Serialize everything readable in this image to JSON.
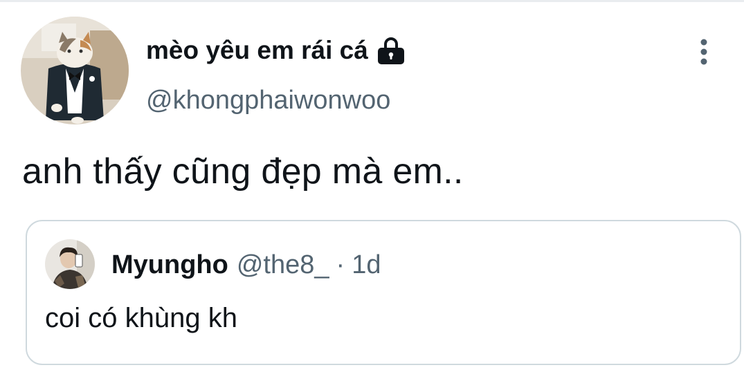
{
  "tweet": {
    "author": {
      "display_name": "mèo yêu em rái cá",
      "handle": "@khongphaiwonwoo",
      "avatar_icon": "cat-in-tuxedo-avatar",
      "protected_icon": "lock-icon"
    },
    "more_icon": "vertical-ellipsis-icon",
    "text": "anh thấy cũng đẹp mà em..",
    "quoted": {
      "display_name": "Myungho",
      "handle": "@the8_",
      "separator": "·",
      "time": "1d",
      "avatar_icon": "person-mirror-selfie-avatar",
      "text": "coi có khùng kh"
    }
  },
  "colors": {
    "text_primary": "#0f1419",
    "text_secondary": "#536471",
    "border": "#cfd9de"
  }
}
